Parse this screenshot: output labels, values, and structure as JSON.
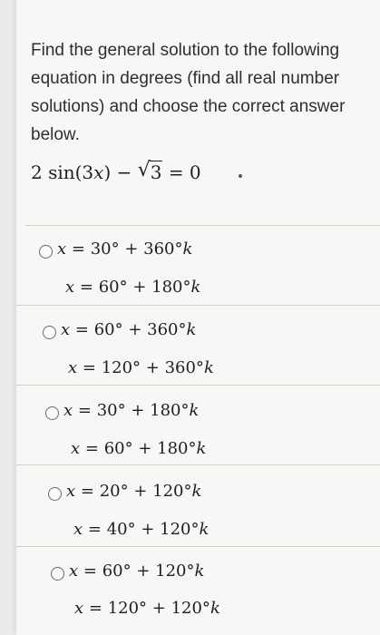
{
  "question": {
    "text": "Find the general solution to the following equation in degrees (find all real number solutions) and choose the correct answer below."
  },
  "equation": {
    "lhs_prefix": "2 sin(3",
    "var": "x",
    "lhs_suffix": ") −",
    "radicand": "3",
    "rhs": "= 0"
  },
  "options": [
    {
      "line1": "= 30° + 360°",
      "line2": "= 60° + 180°"
    },
    {
      "line1": "= 60° + 360°",
      "line2": "= 120° + 360°"
    },
    {
      "line1": "= 30° + 180°",
      "line2": "= 60° + 180°"
    },
    {
      "line1": "= 20° + 120°",
      "line2": "= 40° + 120°"
    },
    {
      "line1": "= 60° + 120°",
      "line2": "= 120° + 120°"
    }
  ],
  "var_x": "x",
  "var_k": "k"
}
